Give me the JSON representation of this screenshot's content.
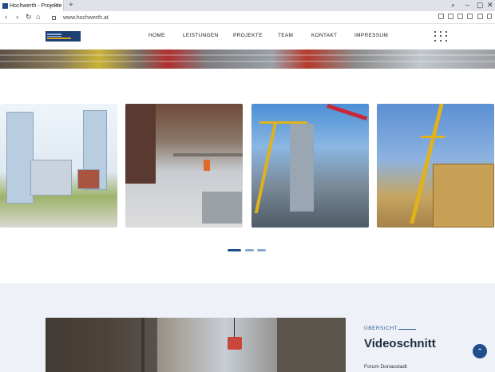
{
  "browser": {
    "tab_title": "Hochwerth - Projekte",
    "tab_close": "×",
    "new_tab": "+",
    "url": "www.hochwerth.at",
    "nav": {
      "back": "‹",
      "forward": "›",
      "reload": "↻",
      "home": "⌂"
    },
    "window": {
      "minimize": "–",
      "maximize": "▢",
      "close": "✕",
      "search": "⌕"
    }
  },
  "site": {
    "logo_alt": "Hochwerth logo",
    "menu": [
      "HOME",
      "LEISTUNGEN",
      "PROJEKTE",
      "TEAM",
      "KONTAKT",
      "IMPRESSUM"
    ]
  },
  "gallery": {
    "images": [
      "high-rise-rendering",
      "formwork-site",
      "crane-tower-aerial",
      "crane-scaffold"
    ],
    "pages": 3,
    "active_page": 1
  },
  "overview": {
    "kicker": "ÜBERSICHT",
    "title": "Videoschnitt",
    "subtitle": "Forum Donaustadt"
  },
  "colors": {
    "accent": "#1f4e8a",
    "heading": "#1b2a41",
    "section_bg": "#eef2f8"
  },
  "scroll_top": "⌃"
}
